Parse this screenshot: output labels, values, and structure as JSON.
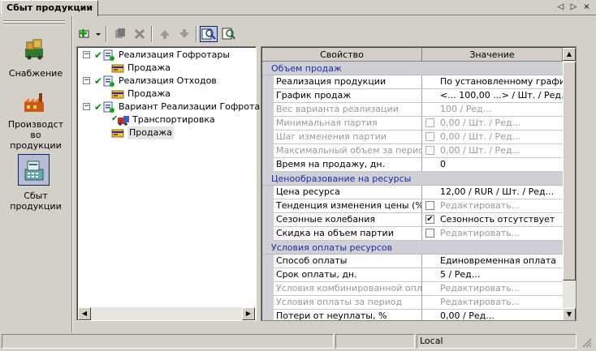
{
  "tab": {
    "title": "Сбыт продукции"
  },
  "nav_buttons": [
    "◁",
    "▷",
    "×"
  ],
  "left_nav": [
    {
      "label": "Снабжение",
      "icon": "supply-icon"
    },
    {
      "label": "Производст\nво\nпродукции",
      "icon": "production-icon"
    },
    {
      "label": "Сбыт\nпродукции",
      "icon": "sales-icon"
    }
  ],
  "tree": [
    {
      "label": "Реализация Гофротары",
      "level": 0,
      "expanded": true
    },
    {
      "label": "Продажа",
      "level": 1
    },
    {
      "label": "Реализация Отходов",
      "level": 0,
      "expanded": true
    },
    {
      "label": "Продажа",
      "level": 1
    },
    {
      "label": "Вариант Реализации Гофротары",
      "level": 0,
      "expanded": true
    },
    {
      "label": "Транспортировка",
      "level": 1
    },
    {
      "label": "Продажа",
      "level": 1,
      "selected": true
    }
  ],
  "grid": {
    "col_property": "Свойство",
    "col_value": "Значение",
    "rows": [
      {
        "cat": "Объем продаж"
      },
      {
        "p": "Реализация продукции",
        "v": "По установленному графику"
      },
      {
        "p": "График продаж",
        "v": "<... 100,00 ...> / Шт. / Ред..."
      },
      {
        "p": "Вес варианта реализации",
        "v": "100 / Ред...",
        "dis": true
      },
      {
        "p": "Минимальная партия",
        "v": "0,00 / Шт. / Ред...",
        "dis": true,
        "cb": ""
      },
      {
        "p": "Шаг изменения партии",
        "v": "0,00 / Шт. / Ред...",
        "dis": true,
        "cb": ""
      },
      {
        "p": "Максимальный объем за период",
        "v": "0,00 / Шт. / Ред...",
        "dis": true,
        "cb": ""
      },
      {
        "p": "Время на продажу, дн.",
        "v": "0"
      },
      {
        "cat": "Ценообразование на ресурсы"
      },
      {
        "p": "Цена ресурса",
        "v": "12,00 / RUR / Шт. / Ред..."
      },
      {
        "p": "Тенденция изменения цены (%)",
        "v": "Редактировать...",
        "vdis": true,
        "cb": ""
      },
      {
        "p": "Сезонные колебания",
        "v": "Сезонность отсутствует",
        "cb": "✔"
      },
      {
        "p": "Скидка на объем партии",
        "v": "Редактировать...",
        "vdis": true,
        "cb": ""
      },
      {
        "cat": "Условия оплаты ресурсов"
      },
      {
        "p": "Способ оплаты",
        "v": "Единовременная оплата"
      },
      {
        "p": "Срок оплаты, дн.",
        "v": "5 / Ред..."
      },
      {
        "p": "Условия комбинированной оплаты",
        "v": "Редактировать...",
        "dis": true
      },
      {
        "p": "Условия оплаты за период",
        "v": "Редактировать...",
        "dis": true
      },
      {
        "p": "Потери от неуплаты, %",
        "v": "0,00 / Ред..."
      }
    ]
  },
  "status": {
    "panel1": "",
    "panel2": "",
    "panel3": "Local"
  }
}
